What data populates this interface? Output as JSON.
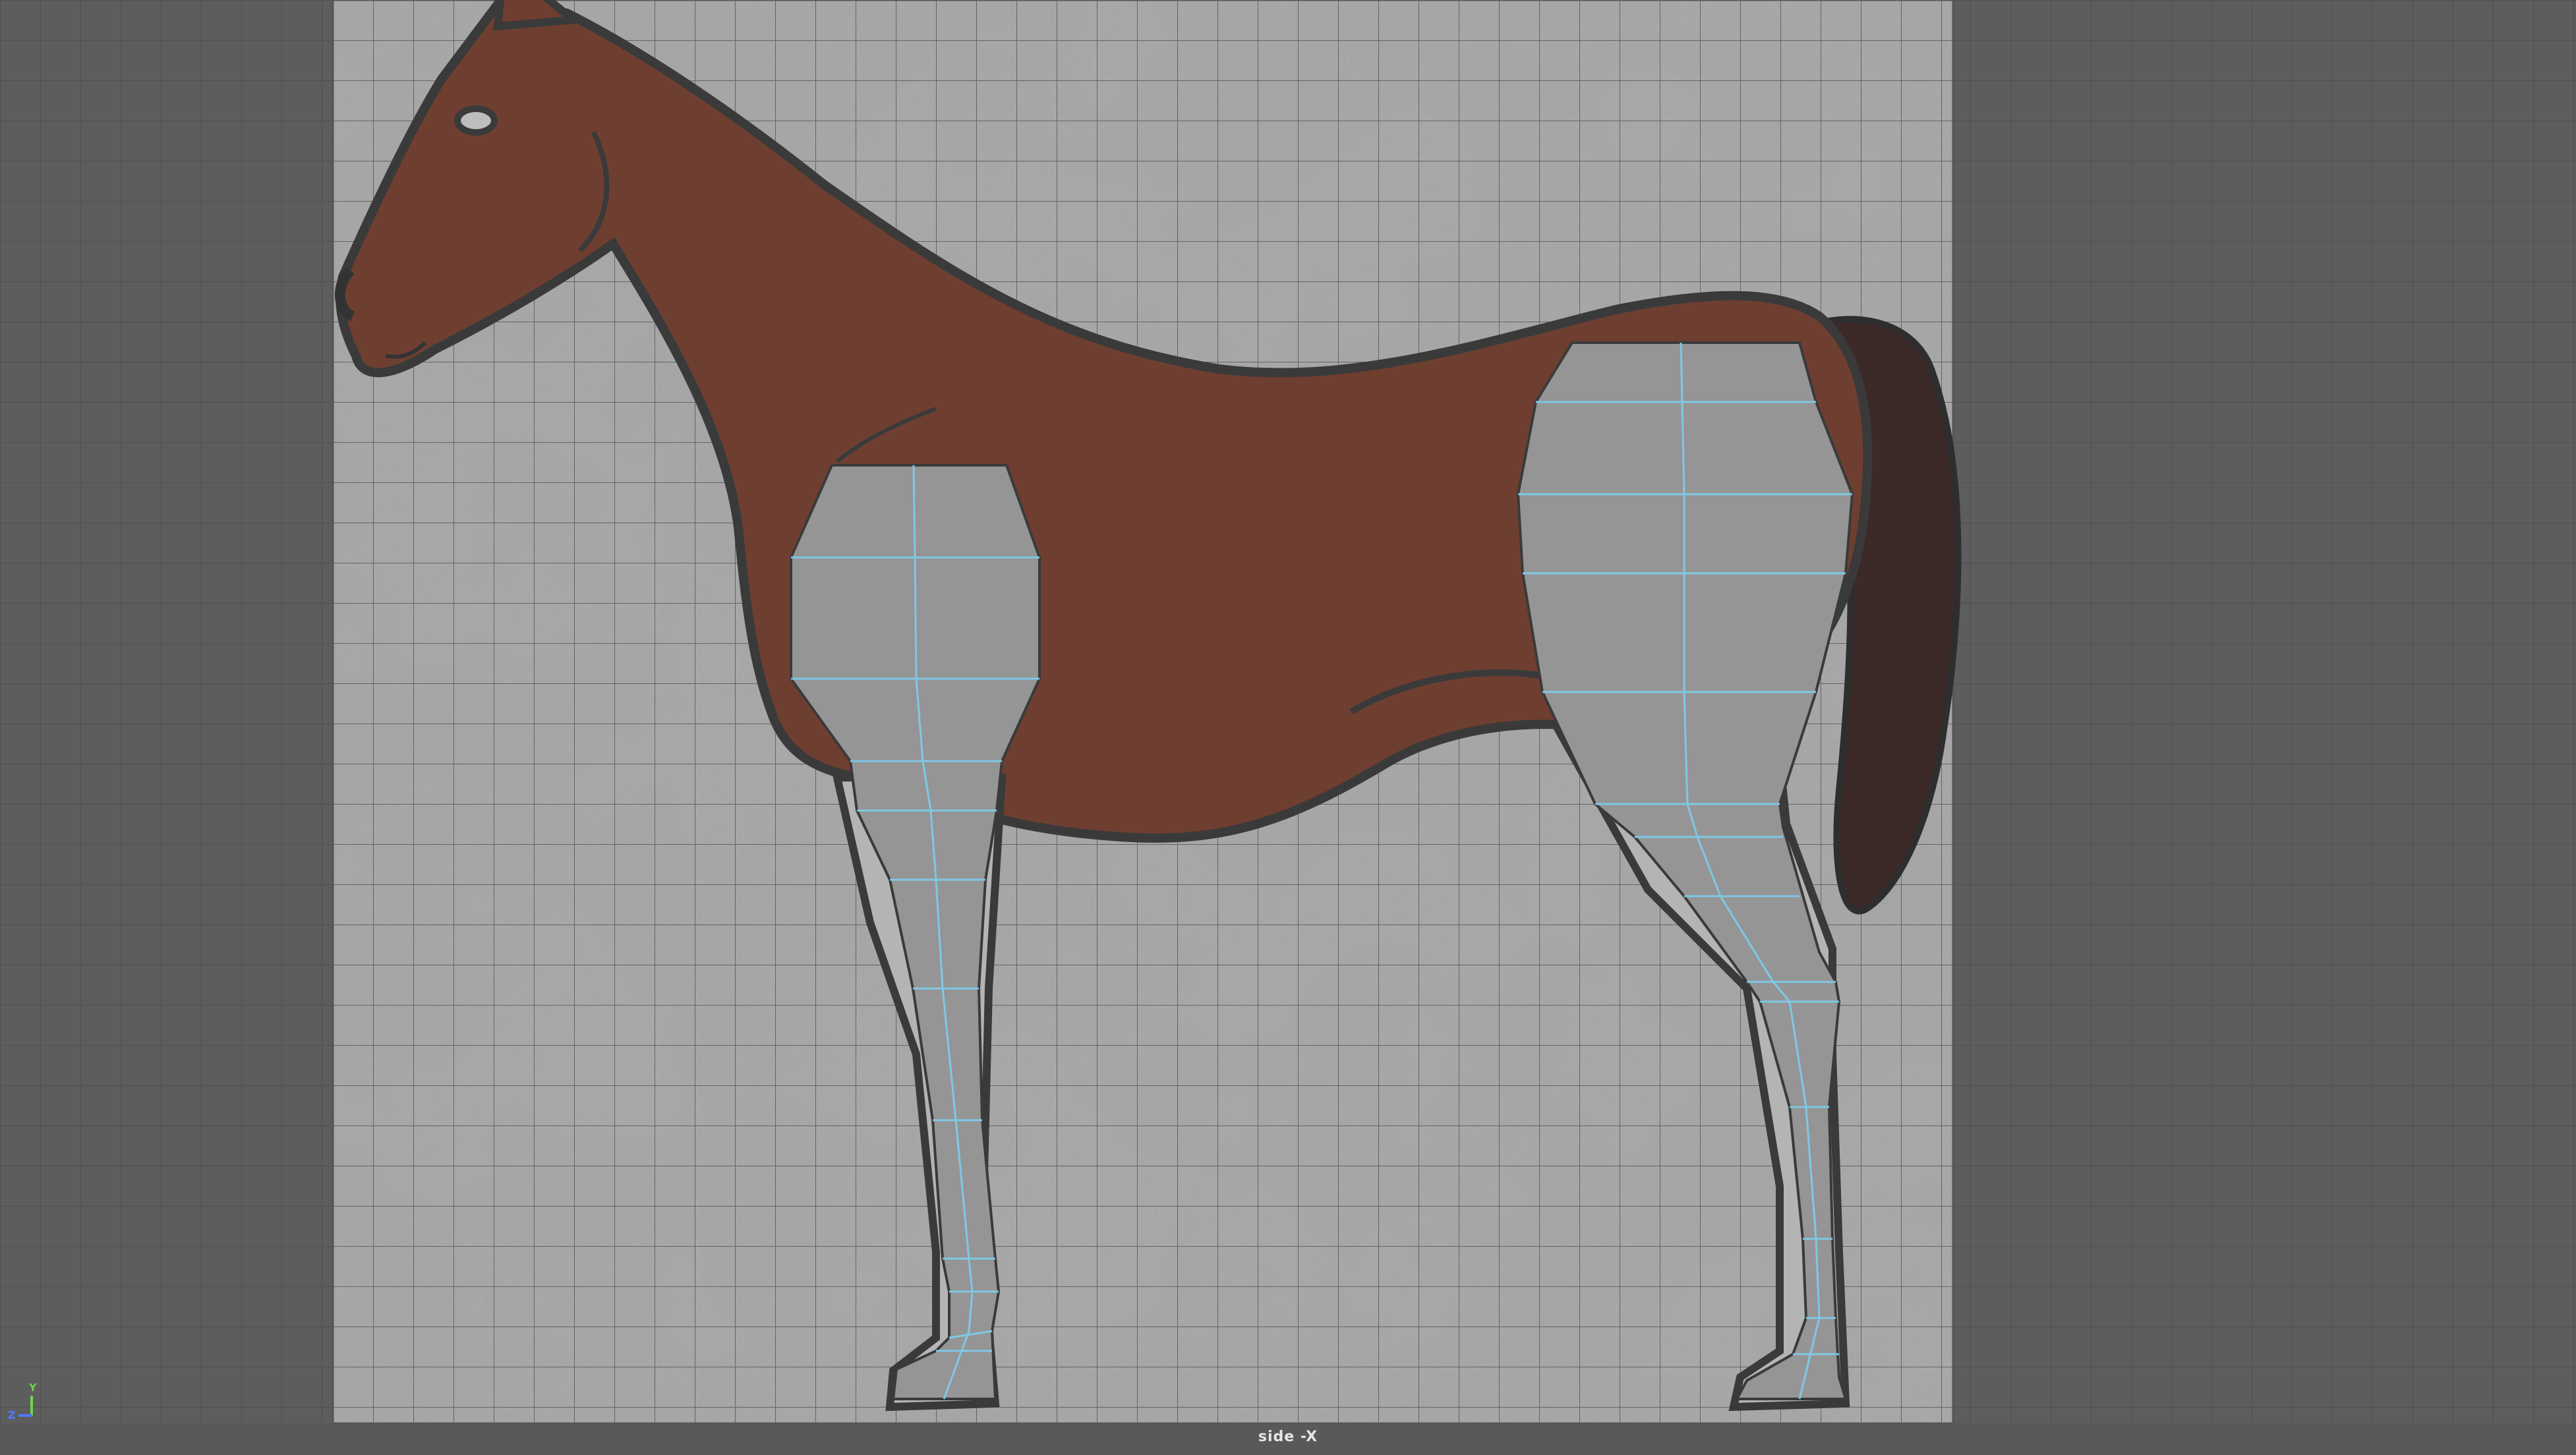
{
  "viewport": {
    "view_name": "side -X",
    "panel_colors": {
      "outer_background": "#5d5d5d",
      "image_plane_paper": "#a2a2a2",
      "grid_line": "#444444",
      "model_fill": "#959595",
      "wireframe_edge": "#7ec8e6",
      "horse_body": "#6e3f31",
      "horse_outline": "#3a3a3a",
      "horse_tail": "#3b2a27"
    }
  },
  "axis_gizmo": {
    "y_label": "Y",
    "z_label": "Z",
    "y_color": "#6ed24c",
    "z_color": "#4d7cff"
  }
}
